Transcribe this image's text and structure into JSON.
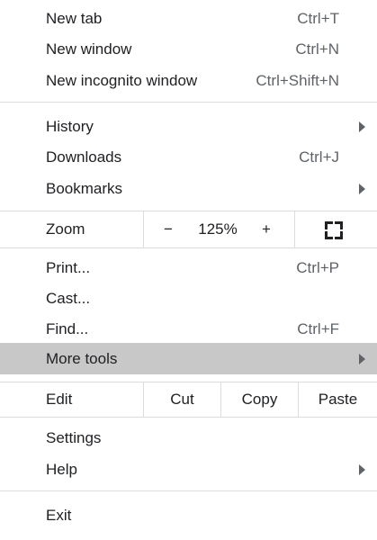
{
  "group1": [
    {
      "label": "New tab",
      "shortcut": "Ctrl+T"
    },
    {
      "label": "New window",
      "shortcut": "Ctrl+N"
    },
    {
      "label": "New incognito window",
      "shortcut": "Ctrl+Shift+N"
    }
  ],
  "group2": [
    {
      "label": "History"
    },
    {
      "label": "Downloads",
      "shortcut": "Ctrl+J"
    },
    {
      "label": "Bookmarks"
    }
  ],
  "zoom": {
    "label": "Zoom",
    "minus": "−",
    "value": "125%",
    "plus": "+",
    "fullscreen_icon": "fullscreen-icon"
  },
  "group3": [
    {
      "label": "Print...",
      "shortcut": "Ctrl+P"
    },
    {
      "label": "Cast..."
    },
    {
      "label": "Find...",
      "shortcut": "Ctrl+F"
    },
    {
      "label": "More tools"
    }
  ],
  "edit": {
    "label": "Edit",
    "cut": "Cut",
    "copy": "Copy",
    "paste": "Paste"
  },
  "group4": [
    {
      "label": "Settings"
    },
    {
      "label": "Help"
    }
  ],
  "group5": [
    {
      "label": "Exit"
    }
  ],
  "colors": {
    "highlight": "#c8c8c8",
    "separator": "#dadce0",
    "text": "#202124",
    "shortcut": "#5f6368"
  }
}
